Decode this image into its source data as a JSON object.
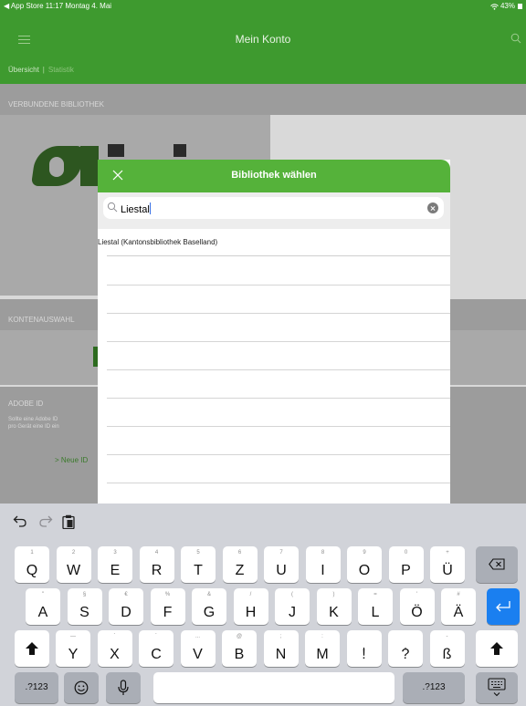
{
  "status_bar": {
    "left": "◀ App Store  11:17  Montag 4. Mai",
    "battery": "43%"
  },
  "nav": {
    "title": "Mein Konto"
  },
  "subtabs": {
    "overview": "Übersicht",
    "separator": "|",
    "statistics": "Statistik"
  },
  "sections": {
    "library_label": "VERBUNDENE BIBLIOTHEK",
    "accounts_label": "KONTENAUSWAHL",
    "adobe_title": "ADOBE ID",
    "adobe_text_1": "Sollte eine Adobe ID",
    "adobe_text_2": "pro Gerät eine ID ein",
    "adobe_link": "> Neue ID"
  },
  "modal": {
    "title": "Bibliothek wählen",
    "search_value": "Liestal",
    "results": [
      "Liestal (Kantonsbibliothek Baselland)"
    ]
  },
  "keyboard": {
    "colors": {
      "key": "#ffffff",
      "dark_key": "#aaaeb6",
      "return_key": "#1a7ff0",
      "background": "#d1d3d9"
    },
    "row1": [
      {
        "main": "Q",
        "hint": "1"
      },
      {
        "main": "W",
        "hint": "2"
      },
      {
        "main": "E",
        "hint": "3"
      },
      {
        "main": "R",
        "hint": "4"
      },
      {
        "main": "T",
        "hint": "5"
      },
      {
        "main": "Z",
        "hint": "6"
      },
      {
        "main": "U",
        "hint": "7"
      },
      {
        "main": "I",
        "hint": "8"
      },
      {
        "main": "O",
        "hint": "9"
      },
      {
        "main": "P",
        "hint": "0"
      },
      {
        "main": "Ü",
        "hint": "+"
      }
    ],
    "row2": [
      {
        "main": "A",
        "hint": "\""
      },
      {
        "main": "S",
        "hint": "§"
      },
      {
        "main": "D",
        "hint": "€"
      },
      {
        "main": "F",
        "hint": "%"
      },
      {
        "main": "G",
        "hint": "&"
      },
      {
        "main": "H",
        "hint": "/"
      },
      {
        "main": "J",
        "hint": "("
      },
      {
        "main": "K",
        "hint": ")"
      },
      {
        "main": "L",
        "hint": "="
      },
      {
        "main": "Ö",
        "hint": "'"
      },
      {
        "main": "Ä",
        "hint": "#"
      }
    ],
    "row3": [
      {
        "main": "Y",
        "hint": "—"
      },
      {
        "main": "X",
        "hint": "`"
      },
      {
        "main": "C",
        "hint": "´"
      },
      {
        "main": "V",
        "hint": "..."
      },
      {
        "main": "B",
        "hint": "@"
      },
      {
        "main": "N",
        "hint": ";"
      },
      {
        "main": "M",
        "hint": ":"
      },
      {
        "main": "!",
        "hint": ""
      },
      {
        "main": "?",
        "hint": ""
      },
      {
        "main": "ß",
        "hint": "-"
      }
    ],
    "row3_small": [
      "",
      "",
      "",
      "",
      "",
      "",
      "",
      ",",
      ".",
      ""
    ],
    "numbers_key": ".?123",
    "numbers_key_right": ".?123"
  }
}
